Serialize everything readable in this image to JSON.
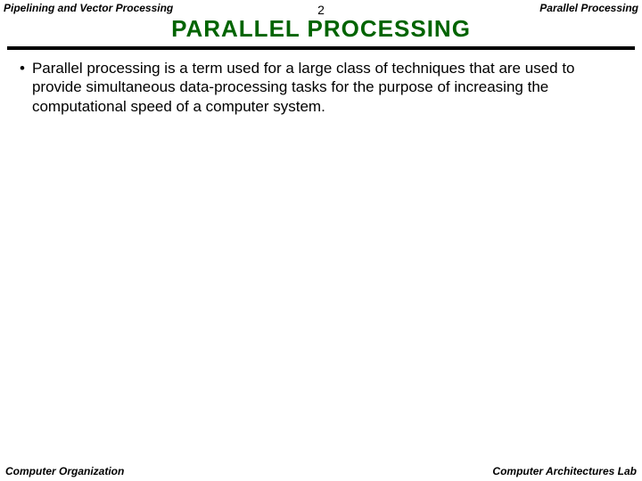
{
  "header": {
    "left": "Pipelining and Vector Processing",
    "center": "2",
    "right": "Parallel Processing"
  },
  "title": "PARALLEL  PROCESSING",
  "body": {
    "bullet1": "Parallel processing is a term used for a large class of techniques that are used to provide simultaneous data-processing tasks for the purpose of increasing the computational speed of a computer system."
  },
  "footer": {
    "left": "Computer Organization",
    "right": "Computer Architectures Lab"
  }
}
